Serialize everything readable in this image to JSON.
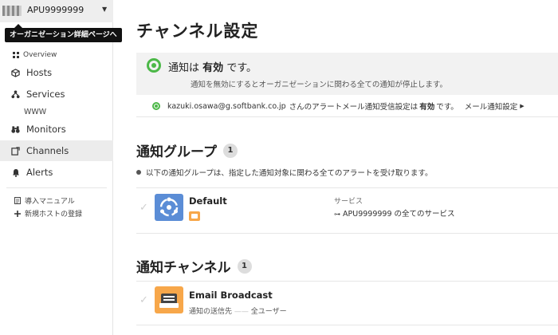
{
  "org": {
    "name": "APU9999999",
    "tooltip": "オーガニゼーション詳細ページへ"
  },
  "sidebar": {
    "overview": "Overview",
    "items": [
      {
        "label": "Hosts",
        "icon": "cube-icon"
      },
      {
        "label": "Services",
        "icon": "sitemap-icon"
      },
      {
        "label": "Monitors",
        "icon": "binoculars-icon"
      },
      {
        "label": "Channels",
        "icon": "channel-icon"
      },
      {
        "label": "Alerts",
        "icon": "bell-icon"
      }
    ],
    "service_sub": "WWW",
    "links": [
      "導入マニュアル",
      "新規ホストの登録"
    ]
  },
  "page": {
    "title": "チャンネル設定",
    "notice": {
      "prefix": "通知は",
      "state": "有効",
      "suffix": "です。",
      "sub": "通知を無効にするとオーガニゼーションに関わる全ての通知が停止します。"
    },
    "mail": {
      "email": "kazuki.osawa@g.softbank.co.jp",
      "text": "さんのアラートメール通知受信設定は",
      "state": "有効",
      "suffix": "です。",
      "link": "メール通知設定"
    }
  },
  "groups": {
    "title": "通知グループ",
    "count": "1",
    "desc": "以下の通知グループは、指定した通知対象に関わる全てのアラートを受け取ります。",
    "items": [
      {
        "name": "Default",
        "service_label": "サービス",
        "service_value": "APU9999999 の全てのサービス"
      }
    ]
  },
  "channels": {
    "title": "通知チャンネル",
    "count": "1",
    "items": [
      {
        "name": "Email Broadcast",
        "dest_label": "通知の送信先",
        "dest_value": "全ユーザー"
      }
    ]
  },
  "colors": {
    "accent_green": "#4cb848",
    "group_icon": "#5b8dd6",
    "channel_icon": "#f7a74a"
  }
}
